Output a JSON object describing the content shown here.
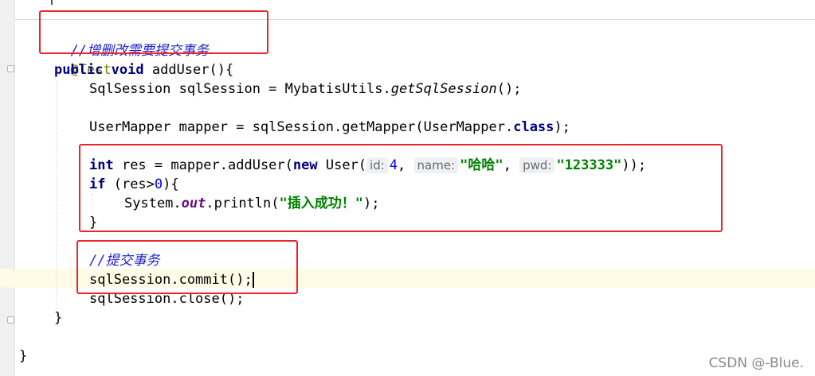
{
  "editor": {
    "comment_crud": "//增删改需要提交事务",
    "annotation": "@Test",
    "kw_public": "public",
    "kw_void": "void",
    "method_sig": " addUser(){",
    "session_decl": "SqlSession sqlSession = MybatisUtils.",
    "get_session": "getSqlSession",
    "session_end": "();",
    "mapper_decl": "UserMapper mapper = sqlSession.getMapper(UserMapper.",
    "kw_class": "class",
    "mapper_end": ");",
    "kw_int": "int",
    "res_assign": " res = mapper.addUser(",
    "kw_new": "new",
    "user_ctor": " User(",
    "hint_id": "id:",
    "val_id": "4",
    "comma1": ", ",
    "hint_name": "name:",
    "val_name": "\"哈哈\"",
    "comma2": ", ",
    "hint_pwd": "pwd:",
    "val_pwd": "\"123333\"",
    "call_end": "));",
    "kw_if": "if",
    "if_open": " (res>",
    "zero": "0",
    "if_close": "){",
    "sys": "System.",
    "out": "out",
    "println": ".println(",
    "msg": "\"插入成功！\"",
    "println_end": ");",
    "brace_close": "}",
    "comment_commit": "//提交事务",
    "commit_stmt": "sqlSession.commit();",
    "close_stmt": "sqlSession.close();",
    "method_close": "}",
    "class_close": "}"
  },
  "watermark": "CSDN @-Blue.",
  "colors": {
    "highlight_box": "#e8262b",
    "keyword": "#000080",
    "comment": "#2323c8",
    "string": "#008000",
    "number": "#0000ff"
  }
}
